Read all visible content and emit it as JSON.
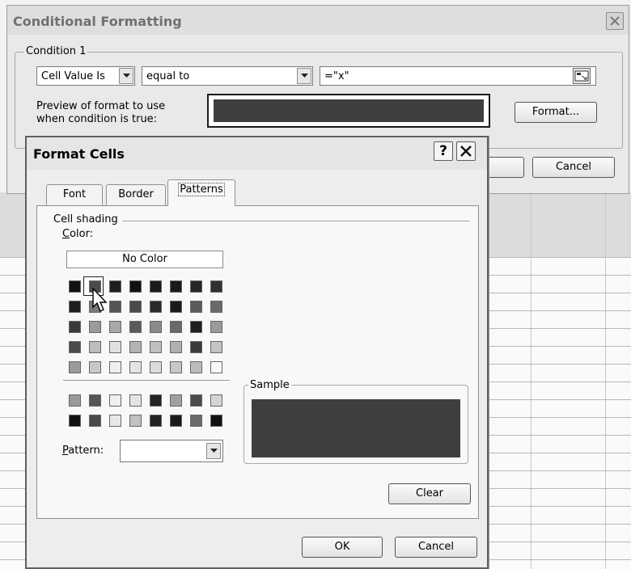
{
  "conditional_formatting": {
    "title": "Conditional Formatting",
    "condition_group_label": "Condition 1",
    "cell_value_combo": "Cell Value Is",
    "operator_combo": "equal to",
    "value_field": "=\"x\"",
    "preview_label_line1": "Preview of format to use",
    "preview_label_line2": "when condition is true:",
    "format_button": "Format...",
    "cancel_button": "Cancel",
    "preview_color": "#3f3f3f"
  },
  "format_cells": {
    "title": "Format Cells",
    "help_button": "?",
    "tabs": [
      {
        "label": "Font"
      },
      {
        "label": "Border"
      },
      {
        "label": "Patterns",
        "active": true
      }
    ],
    "cell_shading_label": "Cell shading",
    "color_label": "Color:",
    "no_color_button": "No Color",
    "sample_label": "Sample",
    "sample_color": "#3e3e3e",
    "pattern_label": "Pattern:",
    "pattern_value": "",
    "clear_button": "Clear",
    "ok_button": "OK",
    "cancel_button": "Cancel",
    "palette_main": [
      [
        "#111111",
        "#4a4a4a",
        "#1e1e1e",
        "#111111",
        "#1a1a1a",
        "#1a1a1a",
        "#262626",
        "#303030"
      ],
      [
        "#1e1e1e",
        "#7a7a7a",
        "#555555",
        "#4a4a4a",
        "#2a2a2a",
        "#1a1a1a",
        "#5a5a5a",
        "#6a6a6a"
      ],
      [
        "#3a3a3a",
        "#9a9a9a",
        "#a8a8a8",
        "#5a5a5a",
        "#8a8a8a",
        "#6a6a6a",
        "#1e1e1e",
        "#9a9a9a"
      ],
      [
        "#4a4a4a",
        "#bcbcbc",
        "#e0e0e0",
        "#b4b4b4",
        "#c0c0c0",
        "#b0b0b0",
        "#3a3a3a",
        "#c4c4c4"
      ],
      [
        "#9a9a9a",
        "#c8c8c8",
        "#efefef",
        "#e4e4e4",
        "#dcdcdc",
        "#c8c8c8",
        "#bcbcbc",
        "#f8f8f8"
      ]
    ],
    "palette_extra": [
      [
        "#9a9a9a",
        "#555555",
        "#efefef",
        "#e4e4e4",
        "#222222",
        "#a0a0a0",
        "#4a4a4a",
        "#d4d4d4"
      ],
      [
        "#111111",
        "#4a4a4a",
        "#e8e8e8",
        "#c0c0c0",
        "#222222",
        "#1a1a1a",
        "#6a6a6a",
        "#111111"
      ]
    ],
    "selected_swatch_color": "#4a4a4a"
  }
}
